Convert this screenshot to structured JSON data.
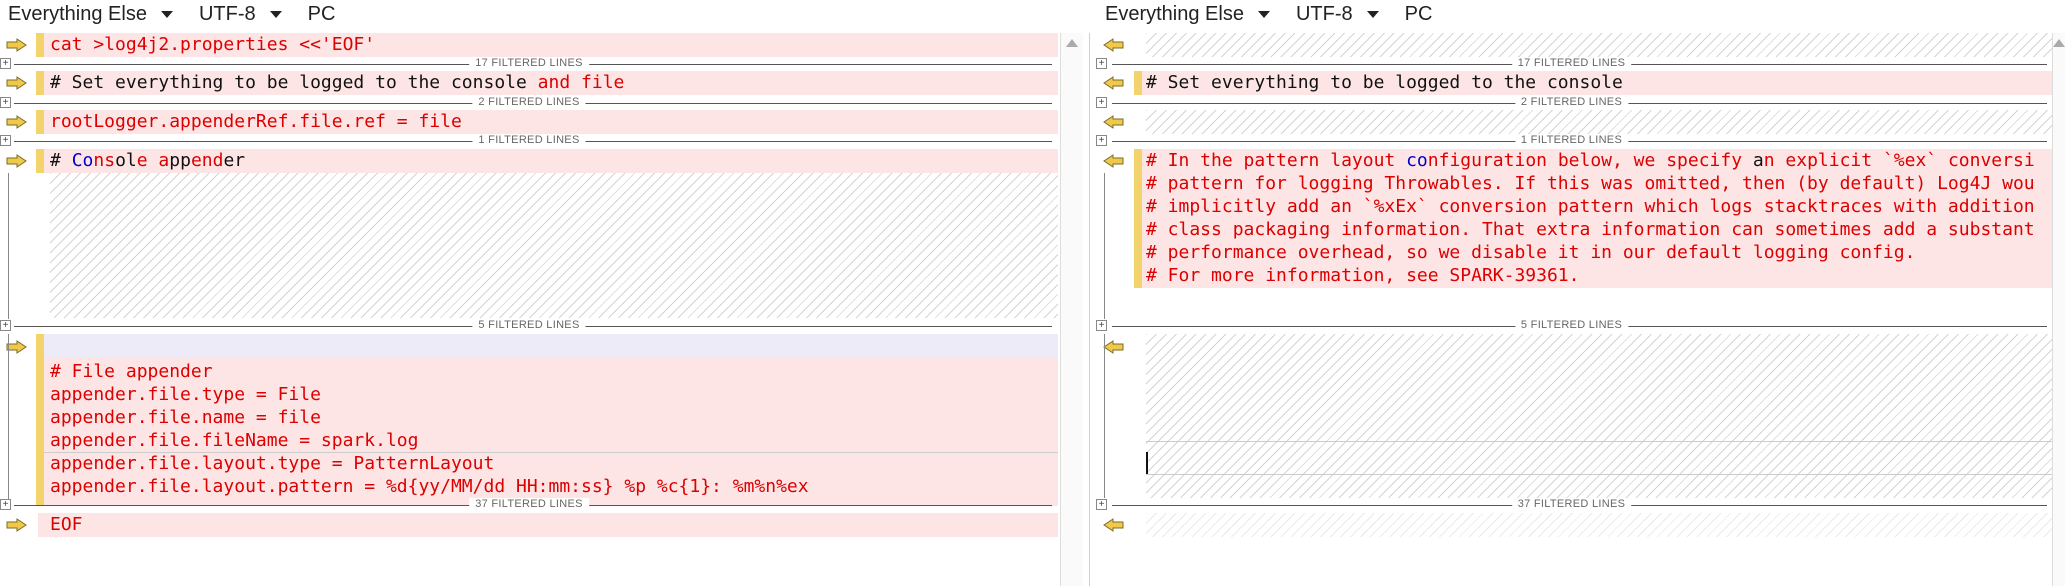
{
  "left": {
    "toolbar": {
      "filter": "Everything Else",
      "encoding": "UTF-8",
      "line_ending": "PC"
    },
    "lines": {
      "l1": "cat >log4j2.properties <<'EOF'",
      "l2a": "# Set everything to be logged to the console ",
      "l2b": "and file",
      "l3": "rootLogger.appenderRef.file.ref = file",
      "l4a": "# ",
      "l4b": "Co",
      "l4c": "ns",
      "l4d": "ol",
      "l4e": "e a",
      "l4f": "pp",
      "l4g": "end",
      "l4h": "er",
      "fa1": "# File appender",
      "fa2": "appender.file.type = File",
      "fa3": "appender.file.name = file",
      "fa4": "appender.file.fileName = spark.log",
      "fa5": "appender.file.layout.type = PatternLayout",
      "fa6": "appender.file.layout.pattern = %d{yy/MM/dd HH:mm:ss} %p %c{1}: %m%n%ex",
      "eof": "EOF"
    },
    "filtered": {
      "f1": "17 FILTERED LINES",
      "f2": "2 FILTERED LINES",
      "f3": "1 FILTERED LINES",
      "f4": "5 FILTERED LINES",
      "f5": "37 FILTERED LINES"
    }
  },
  "right": {
    "toolbar": {
      "filter": "Everything Else",
      "encoding": "UTF-8",
      "line_ending": "PC"
    },
    "lines": {
      "r2": "# Set everything to be logged to the console",
      "c1a": "# In the pattern layout ",
      "c1b": "co",
      "c1c": "nfiguration below, we specify ",
      "c1d": "a",
      "c1e": "n explicit `%ex` conversi",
      "c2": "# pattern for logging Throwables. If this was omitted, then (by default) Log4J wou",
      "c3": "# implicitly add an `%xEx` conversion pattern which logs stacktraces with addition",
      "c4": "# class packaging information. That extra information can sometimes add a substant",
      "c5": "# performance overhead, so we disable it in our default logging config.",
      "c6": "# For more information, see SPARK-39361."
    },
    "filtered": {
      "f1": "17 FILTERED LINES",
      "f2": "2 FILTERED LINES",
      "f3": "1 FILTERED LINES",
      "f4": "5 FILTERED LINES",
      "f5": "37 FILTERED LINES"
    }
  },
  "colors": {
    "removed_bg": "#fde5e5",
    "changed_text": "#dc0000",
    "change_bar": "#f3d36b",
    "arrow_fill": "#f0c94a",
    "blue_text": "#0000cc"
  },
  "icons": {
    "diff_arrow_right": "arrow-right-icon",
    "diff_arrow_left": "arrow-left-icon",
    "expand": "plus-box-icon",
    "dropdown": "chevron-down-icon",
    "scroll_up": "scroll-up-icon"
  }
}
